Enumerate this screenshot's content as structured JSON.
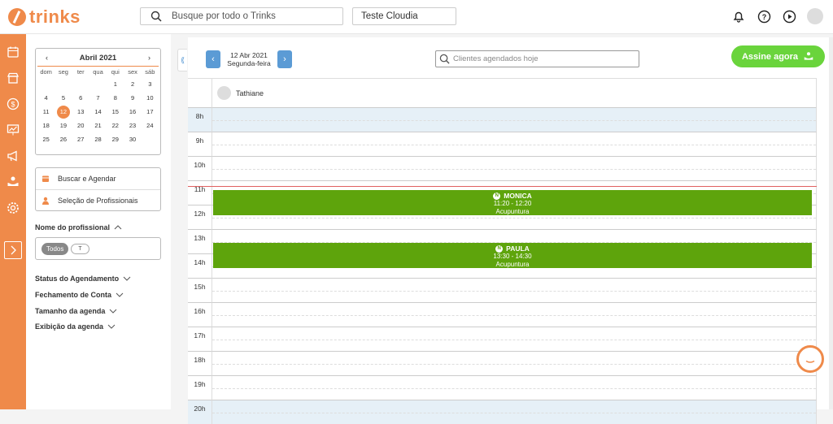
{
  "brand": {
    "name": "trinks",
    "color": "#ef8a4a"
  },
  "header": {
    "search_placeholder": "Busque por todo o Trinks",
    "company": "Teste Cloudia",
    "icons": [
      "bell-icon",
      "help-icon",
      "play-icon",
      "user-avatar-icon"
    ]
  },
  "sidebar": {
    "icons": [
      "agenda-icon",
      "store-icon",
      "money-icon",
      "chart-icon",
      "megaphone-icon",
      "care-icon",
      "settings-icon"
    ],
    "expand_icon": "chevron-right-icon"
  },
  "calendar": {
    "month": "Abril 2021",
    "prev": "‹",
    "next": "›",
    "weekdays": [
      "dom",
      "seg",
      "ter",
      "qua",
      "qui",
      "sex",
      "sáb"
    ],
    "days": [
      "",
      "",
      "",
      "",
      "1",
      "2",
      "3",
      "4",
      "5",
      "6",
      "7",
      "8",
      "9",
      "10",
      "11",
      "12",
      "13",
      "14",
      "15",
      "16",
      "17",
      "18",
      "19",
      "20",
      "21",
      "22",
      "23",
      "24",
      "25",
      "26",
      "27",
      "28",
      "29",
      "30",
      ""
    ],
    "selected": "12"
  },
  "actions": {
    "book": "Buscar e Agendar",
    "professionals": "Seleção de Profissionais"
  },
  "filters": {
    "professional_title": "Nome do profissional",
    "chip_all": "Todos",
    "chip_t": "T",
    "status": "Status do Agendamento",
    "closing": "Fechamento de Conta",
    "size": "Tamanho da agenda",
    "display": "Exibição da agenda"
  },
  "schedule": {
    "date": "12 Abr 2021",
    "weekday": "Segunda-feira",
    "prev": "‹",
    "next": "›",
    "client_search_placeholder": "Clientes agendados hoje",
    "cta": "Assine agora",
    "professional": "Tathiane",
    "hours": [
      "8h",
      "9h",
      "10h",
      "11h",
      "12h",
      "13h",
      "14h",
      "15h",
      "16h",
      "17h",
      "18h",
      "19h",
      "20h"
    ],
    "appointments": [
      {
        "name": "MONICA",
        "time": "11:20 - 12:20",
        "service": "Acupuntura",
        "badge": "N"
      },
      {
        "name": "PAULA",
        "time": "13:30 - 14:30",
        "service": "Acupuntura",
        "badge": "N"
      }
    ]
  }
}
